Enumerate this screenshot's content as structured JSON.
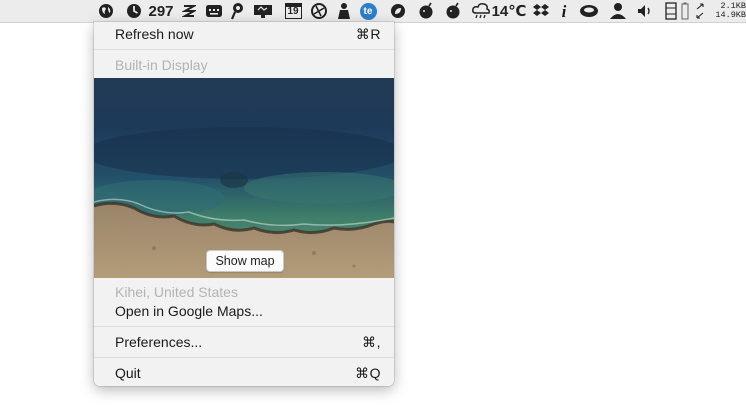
{
  "menubar": {
    "icons": [
      "globe-icon",
      "clock-icon",
      "stripes-icon",
      "keyboard-icon",
      "pushpin-icon",
      "display-icon",
      "calendar-icon",
      "camera-icon",
      "figure-icon",
      "te-app-icon",
      "leaf-icon",
      "bomb-icon",
      "bomb-icon",
      "cloud-icon",
      "dropbox-icon",
      "info-icon",
      "coffee-icon",
      "user-icon",
      "volume-icon",
      "window-icon",
      "battery-icon",
      "arrows-icon"
    ],
    "count_value": "297",
    "calendar_day": "19",
    "te_label": "te",
    "temperature": "14℃",
    "info_glyph": "i",
    "net_upload": "2.1KB",
    "net_download": "14.9KB"
  },
  "menu": {
    "refresh": {
      "label": "Refresh now",
      "shortcut": "⌘R"
    },
    "display_header": "Built-in Display",
    "show_map_label": "Show map",
    "location": "Kihei, United States",
    "open_maps": "Open in Google Maps...",
    "preferences": {
      "label": "Preferences...",
      "shortcut": "⌘,"
    },
    "quit": {
      "label": "Quit",
      "shortcut": "⌘Q"
    }
  },
  "colors": {
    "menu_background": "#f2f2f2",
    "disabled_text": "#b3b3b3",
    "ocean_deep": "#1e3a5a",
    "shallow_water": "#3f7f6a",
    "sand": "#a8906d"
  }
}
